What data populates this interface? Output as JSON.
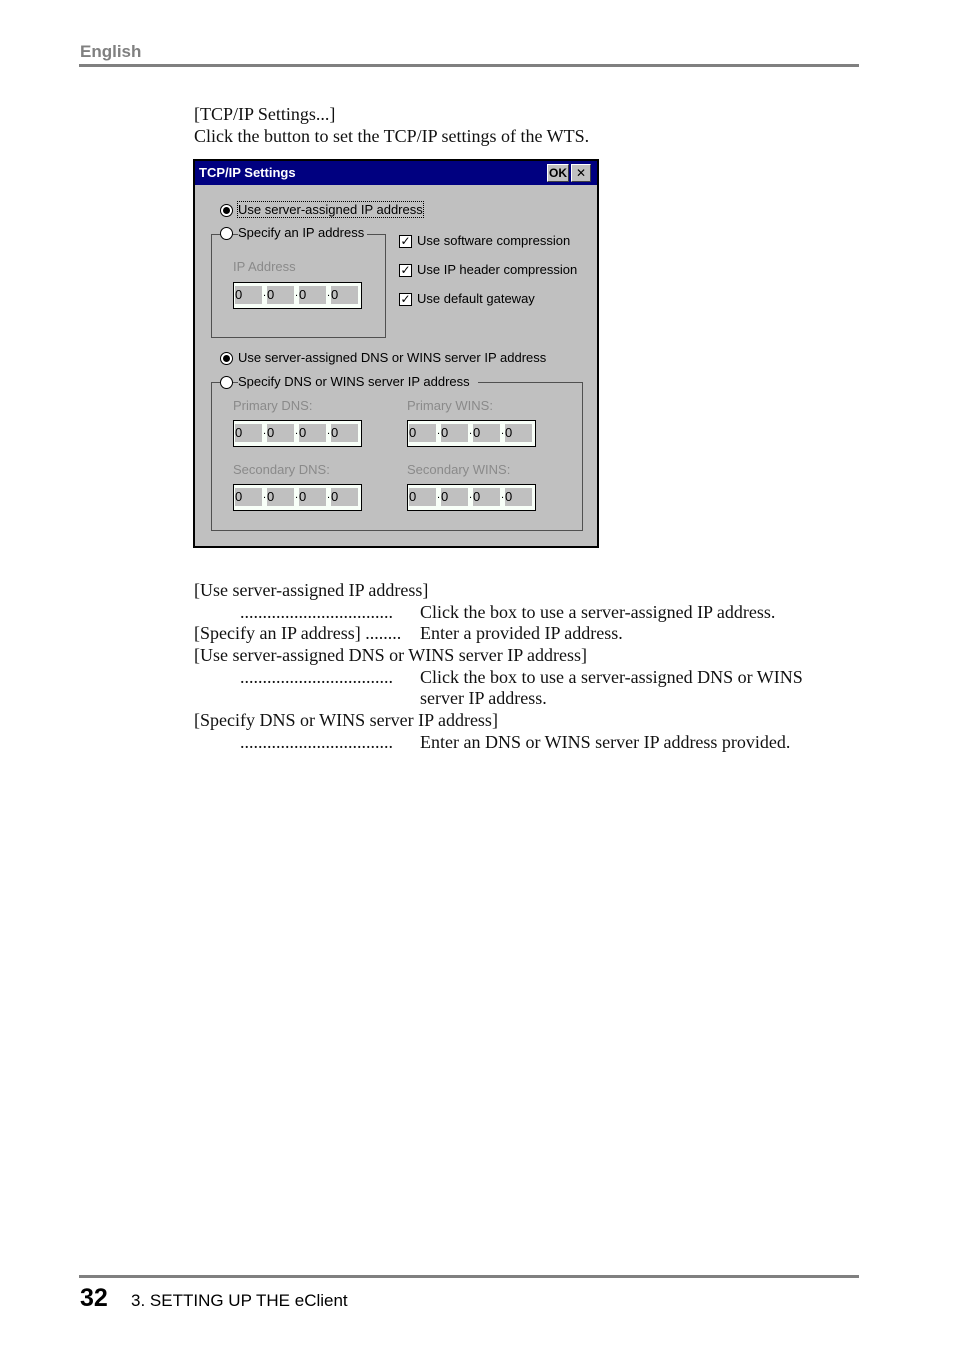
{
  "header": {
    "language": "English"
  },
  "intro": {
    "button_ref": "[TCP/IP Settings...]",
    "description": "Click the button to set the TCP/IP settings of the WTS."
  },
  "dialog": {
    "title": "TCP/IP Settings",
    "ok_label": "OK",
    "close_label": "✕",
    "ip": {
      "use_server_assigned": {
        "label": "Use server-assigned IP address",
        "selected": true
      },
      "specify": {
        "label": "Specify an IP address",
        "selected": false
      },
      "address_label": "IP Address",
      "address": [
        "0",
        "0",
        "0",
        "0"
      ]
    },
    "checkboxes": [
      {
        "label": "Use software compression",
        "checked": true
      },
      {
        "label": "Use IP header compression",
        "checked": true
      },
      {
        "label": "Use default gateway",
        "checked": true
      }
    ],
    "dns": {
      "use_server_assigned": {
        "label": "Use server-assigned DNS or WINS server IP address",
        "selected": true
      },
      "specify": {
        "label": "Specify DNS or WINS server IP address",
        "selected": false
      },
      "primary_dns": {
        "label": "Primary DNS:",
        "value": [
          "0",
          "0",
          "0",
          "0"
        ]
      },
      "primary_wins": {
        "label": "Primary WINS:",
        "value": [
          "0",
          "0",
          "0",
          "0"
        ]
      },
      "secondary_dns": {
        "label": "Secondary DNS:",
        "value": [
          "0",
          "0",
          "0",
          "0"
        ]
      },
      "secondary_wins": {
        "label": "Secondary WINS:",
        "value": [
          "0",
          "0",
          "0",
          "0"
        ]
      }
    }
  },
  "descriptions": [
    {
      "term": "[Use server-assigned IP address]",
      "leader": "..................................",
      "text": "Click the box to use a server-assigned IP address."
    },
    {
      "term": "[Specify an IP address] ........",
      "leader": "",
      "text": "Enter a provided IP address."
    },
    {
      "term": "[Use server-assigned DNS or WINS server IP address]",
      "leader": "..................................",
      "text": "Click the box to use a server-assigned DNS or WINS",
      "text2": "server IP address."
    },
    {
      "term": "[Specify DNS or WINS server IP address]",
      "leader": "..................................",
      "text": "Enter an DNS or WINS server IP address provided."
    }
  ],
  "footer": {
    "page_number": "32",
    "chapter": "3. SETTING UP THE eClient"
  }
}
